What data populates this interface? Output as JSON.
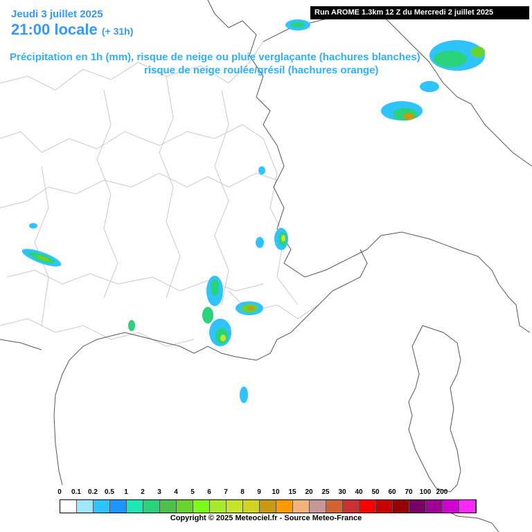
{
  "header": {
    "date": "Jeudi 3 juillet 2025",
    "time": "21:00 locale",
    "offset": "(+ 31h)",
    "desc_line1": "Précipitation en 1h (mm), risque de neige ou pluie verglaçante (hachures blanches)",
    "desc_line2": "risque de neige roulée/grésil (hachures orange)",
    "run": "Run AROME 1.3km 12 Z du Mercredi 2 juillet 2025"
  },
  "legend": {
    "labels": [
      "0",
      "0.1",
      "0.2",
      "0.5",
      "1",
      "2",
      "3",
      "4",
      "5",
      "6",
      "7",
      "8",
      "9",
      "10",
      "15",
      "20",
      "25",
      "30",
      "40",
      "50",
      "60",
      "70",
      "100",
      "200"
    ],
    "colors": [
      "#ffffff",
      "#9ee7fd",
      "#2fc4ff",
      "#1e96ff",
      "#1ee6b4",
      "#2ad27a",
      "#4cc24a",
      "#6ad22e",
      "#7cfa18",
      "#a6ea2a",
      "#c6e42c",
      "#d2d220",
      "#c89a14",
      "#ff9a00",
      "#f2b27a",
      "#c89696",
      "#d26432",
      "#c83232",
      "#ff0000",
      "#c80000",
      "#960000",
      "#780064",
      "#a00096",
      "#d200d2",
      "#ff28ff"
    ]
  },
  "copyright": "Copyright © 2025 Meteociel.fr - Source Meteo-France",
  "colors": {
    "title": "#3399ff",
    "subtitle": "#2fb0ff",
    "coast": "#555555",
    "border": "#c8c8c8"
  }
}
